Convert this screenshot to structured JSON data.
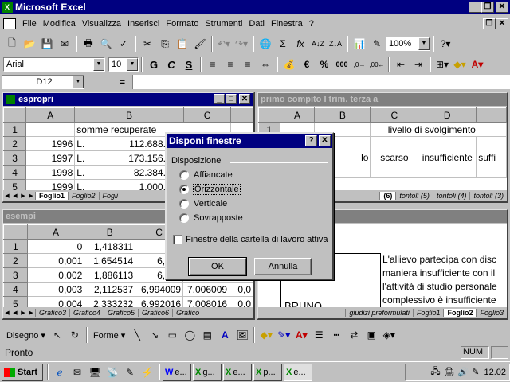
{
  "app": {
    "title": "Microsoft Excel"
  },
  "menu": [
    "File",
    "Modifica",
    "Visualizza",
    "Inserisci",
    "Formato",
    "Strumenti",
    "Dati",
    "Finestra",
    "?"
  ],
  "toolbar": {
    "zoom": "100%"
  },
  "format": {
    "font": "Arial",
    "size": "10",
    "bold": "G",
    "italic": "C",
    "underline": "S",
    "euro": "€",
    "percent": "%",
    "thousands": "000"
  },
  "formula": {
    "cell_ref": "D12",
    "equals": "="
  },
  "win_espropri": {
    "title": "espropri",
    "cols": [
      "A",
      "B",
      "C"
    ],
    "rows": [
      {
        "n": "1",
        "a": "",
        "l": "",
        "b": "somme recuperate",
        "c": ""
      },
      {
        "n": "2",
        "a": "1996",
        "l": "L.",
        "b": "112.688.131",
        "c": ""
      },
      {
        "n": "3",
        "a": "1997",
        "l": "L.",
        "b": "173.156.916",
        "c": ""
      },
      {
        "n": "4",
        "a": "1998",
        "l": "L.",
        "b": "82.384.643",
        "c": ""
      },
      {
        "n": "5",
        "a": "1999",
        "l": "L.",
        "b": "1.000.000",
        "c": ""
      }
    ],
    "tabs": [
      "Foglio1",
      "Foglio2",
      "Fogli"
    ]
  },
  "win_primo": {
    "title": "primo compito I trim. terza a",
    "cols": [
      "A",
      "B",
      "C",
      "D"
    ],
    "row1_label": "livello di svolgimento",
    "row2": [
      "lo",
      "scarso",
      "insufficiente",
      "suffi"
    ],
    "tabs": [
      "(6)",
      "tontoli (5)",
      "tontoli (4)",
      "tontoli (3)"
    ]
  },
  "win_esempi": {
    "title": "esempi",
    "cols": [
      "A",
      "B",
      "C"
    ],
    "rows": [
      {
        "n": "1",
        "a": "0",
        "b": "1,418311",
        "c": "",
        "d": "",
        "e": ""
      },
      {
        "n": "2",
        "a": "0,001",
        "b": "1,654514",
        "c": "6,998",
        "d": "",
        "e": ""
      },
      {
        "n": "3",
        "a": "0,002",
        "b": "1,886113",
        "c": "6,996",
        "d": "",
        "e": ""
      },
      {
        "n": "4",
        "a": "0,003",
        "b": "2,112537",
        "c": "6,994009",
        "d": "7,006009",
        "e": "0,0"
      },
      {
        "n": "5",
        "a": "0,004",
        "b": "2,333232",
        "c": "6,992016",
        "d": "7,008016",
        "e": "0,0"
      }
    ],
    "tabs": [
      "Grafico3",
      "Grafico4",
      "Grafico5",
      "Grafico6",
      "Grafico"
    ]
  },
  "win_giudizi": {
    "lines": [
      "L'allievo partecipa con disc",
      "maniera insufficiente con il",
      "l'attività di studio personale",
      "complessivo è insufficiente"
    ],
    "left_text": "BRUNO",
    "tabs": [
      "giudizi preformulati",
      "Foglio1",
      "Foglio2",
      "Foglio3"
    ]
  },
  "dialog": {
    "title": "Disponi finestre",
    "group": "Disposizione",
    "options": [
      "Affiancate",
      "Orizzontale",
      "Verticale",
      "Sovrapposte"
    ],
    "selected": 1,
    "checkbox": "Finestre della cartella di lavoro attiva",
    "ok": "OK",
    "cancel": "Annulla"
  },
  "drawing": {
    "draw_label": "Disegno",
    "shapes_label": "Forme"
  },
  "status": {
    "text": "Pronto",
    "num": "NUM"
  },
  "taskbar": {
    "start": "Start",
    "tasks": [
      "e...",
      "g...",
      "e...",
      "p...",
      "e..."
    ],
    "clock": "12.02"
  }
}
